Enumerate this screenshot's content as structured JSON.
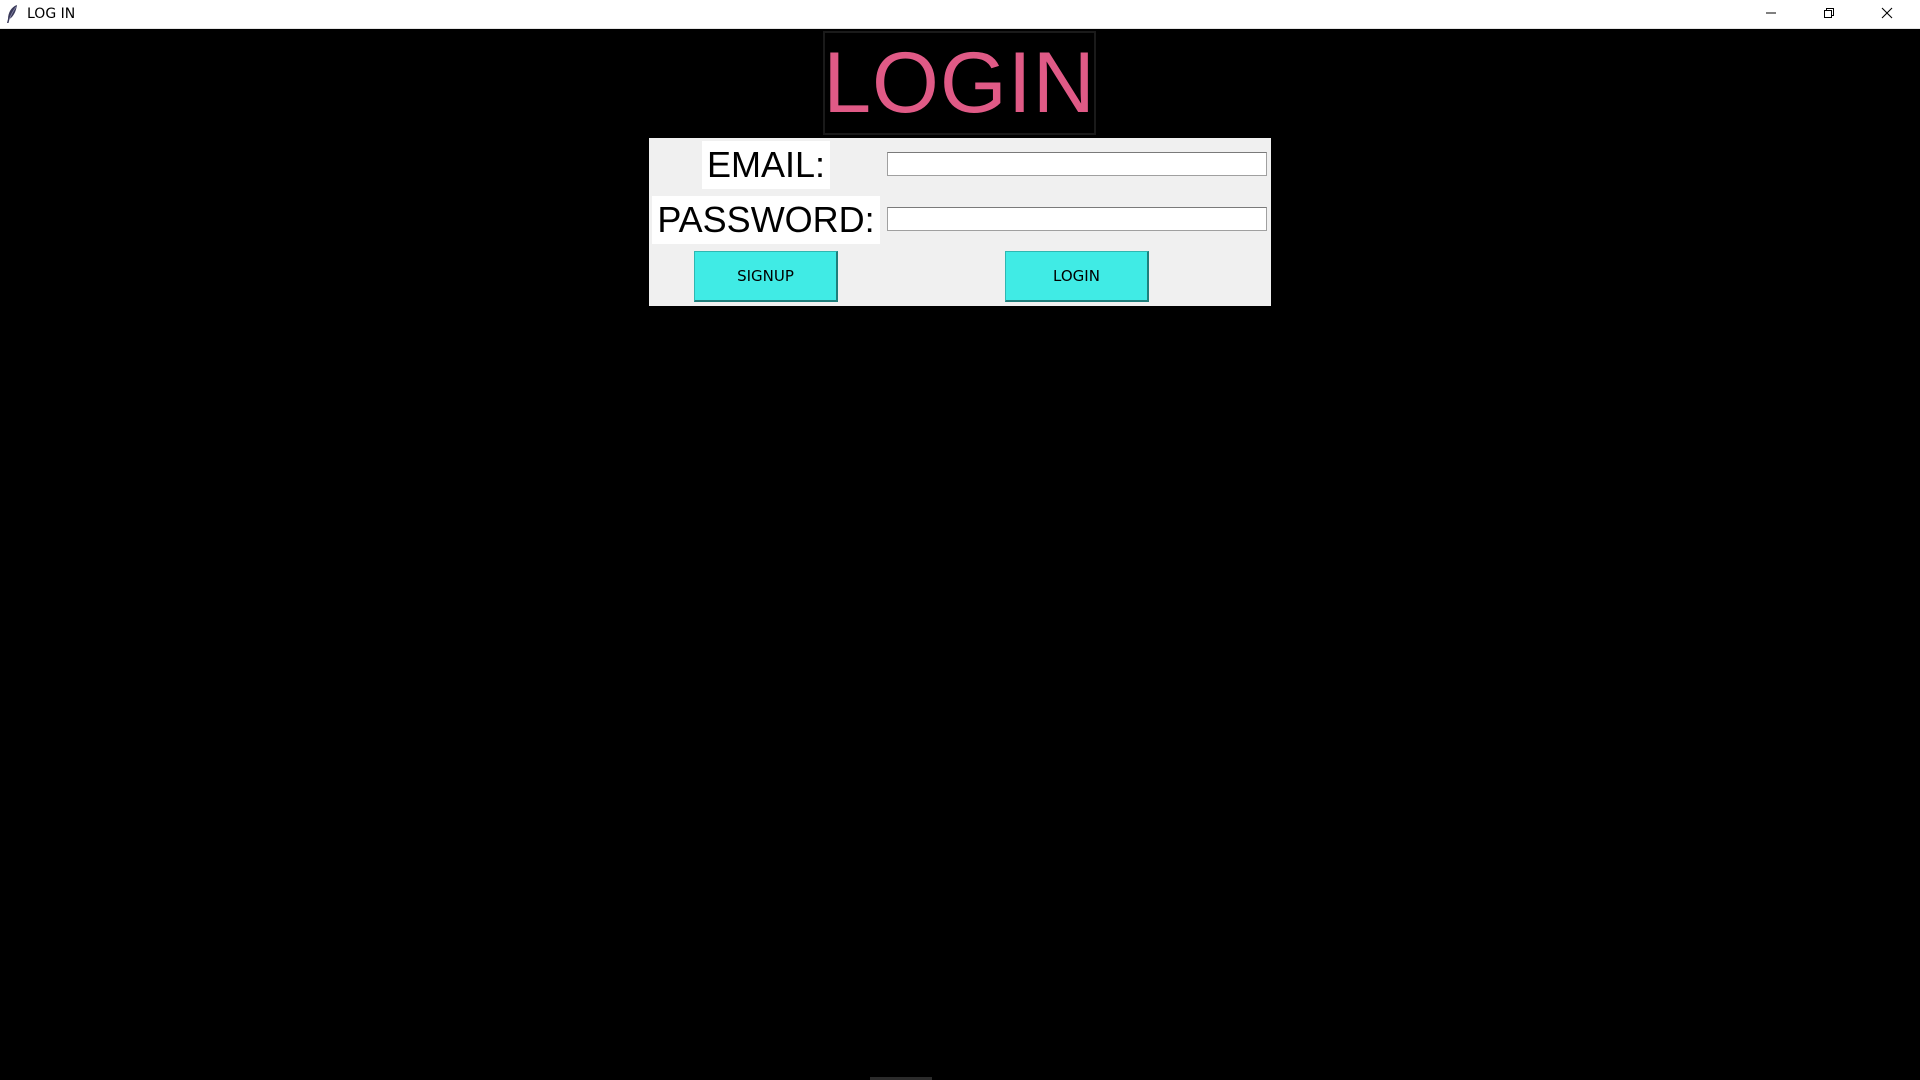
{
  "window": {
    "title": "LOG IN",
    "icons": {
      "app": "feather-icon",
      "minimize": "minimize-icon",
      "maximize": "restore-icon",
      "close": "close-icon"
    }
  },
  "main": {
    "heading": "LOGIN",
    "form": {
      "email_label": "EMAIL:",
      "email_value": "",
      "password_label": "PASSWORD:",
      "password_value": "",
      "signup_label": "SIGNUP",
      "login_label": "LOGIN"
    }
  },
  "colors": {
    "background": "#000000",
    "heading": "#e05a86",
    "panel": "#f0f0f0",
    "button": "#40ebe5"
  }
}
